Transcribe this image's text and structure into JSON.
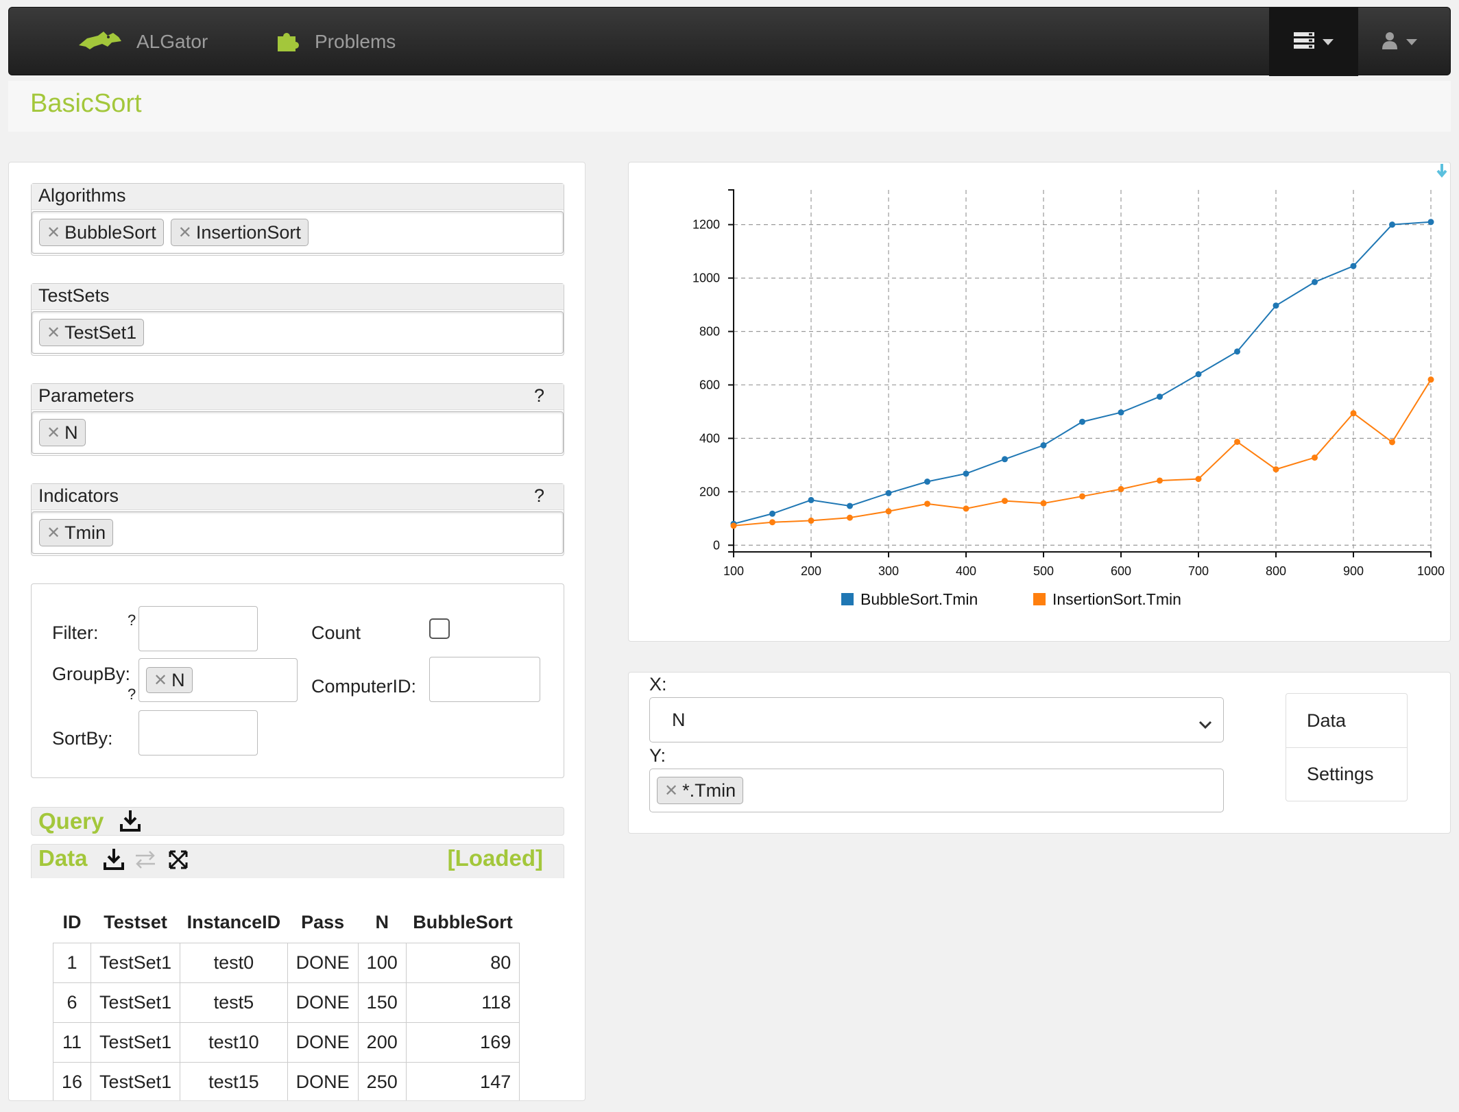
{
  "navbar": {
    "brand": "ALGator",
    "problems": "Problems"
  },
  "page": {
    "title": "BasicSort"
  },
  "algorithms": {
    "label": "Algorithms",
    "tags": [
      "BubbleSort",
      "InsertionSort"
    ]
  },
  "testsets": {
    "label": "TestSets",
    "tags": [
      "TestSet1"
    ]
  },
  "parameters": {
    "label": "Parameters",
    "help": "?",
    "tags": [
      "N"
    ]
  },
  "indicators": {
    "label": "Indicators",
    "help": "?",
    "tags": [
      "Tmin"
    ]
  },
  "filters": {
    "filter_label": "Filter:",
    "groupby_label": "GroupBy:",
    "groupby_tag": "N",
    "sortby_label": "SortBy:",
    "count_label": "Count",
    "computerid_label": "ComputerID:",
    "help": "?"
  },
  "query": {
    "title": "Query"
  },
  "data_section": {
    "title": "Data",
    "status": "[Loaded]"
  },
  "table": {
    "headers": [
      "ID",
      "Testset",
      "InstanceID",
      "Pass",
      "N",
      "BubbleSort"
    ],
    "rows": [
      [
        "1",
        "TestSet1",
        "test0",
        "DONE",
        "100",
        "80"
      ],
      [
        "6",
        "TestSet1",
        "test5",
        "DONE",
        "150",
        "118"
      ],
      [
        "11",
        "TestSet1",
        "test10",
        "DONE",
        "200",
        "169"
      ],
      [
        "16",
        "TestSet1",
        "test15",
        "DONE",
        "250",
        "147"
      ]
    ]
  },
  "controls": {
    "x_label": "X:",
    "x_value": "N",
    "y_label": "Y:",
    "y_tag": "*.Tmin",
    "menu": [
      "Data",
      "Settings"
    ]
  },
  "colors": {
    "accent": "#a3c73b",
    "series_blue": "#1f77b4",
    "series_orange": "#ff7f0e",
    "download_icon": "#5bc0de"
  },
  "chart_data": {
    "type": "line",
    "x": [
      100,
      150,
      200,
      250,
      300,
      350,
      400,
      450,
      500,
      550,
      600,
      650,
      700,
      750,
      800,
      850,
      900,
      950,
      1000
    ],
    "series": [
      {
        "name": "BubbleSort.Tmin",
        "values": [
          80,
          118,
          169,
          147,
          195,
          238,
          268,
          322,
          374,
          462,
          497,
          556,
          640,
          725,
          897,
          985,
          1045,
          1200,
          1210
        ]
      },
      {
        "name": "InsertionSort.Tmin",
        "values": [
          73,
          86,
          92,
          103,
          127,
          155,
          137,
          166,
          157,
          183,
          210,
          242,
          248,
          387,
          284,
          328,
          494,
          386,
          620
        ]
      }
    ],
    "xticks": [
      100,
      200,
      300,
      400,
      500,
      600,
      700,
      800,
      900,
      1000
    ],
    "yticks": [
      0,
      200,
      400,
      600,
      800,
      1000,
      1200
    ],
    "xlim": [
      100,
      1000
    ],
    "ylim": [
      -25,
      1330
    ],
    "grid": true,
    "legend": "bottom"
  }
}
